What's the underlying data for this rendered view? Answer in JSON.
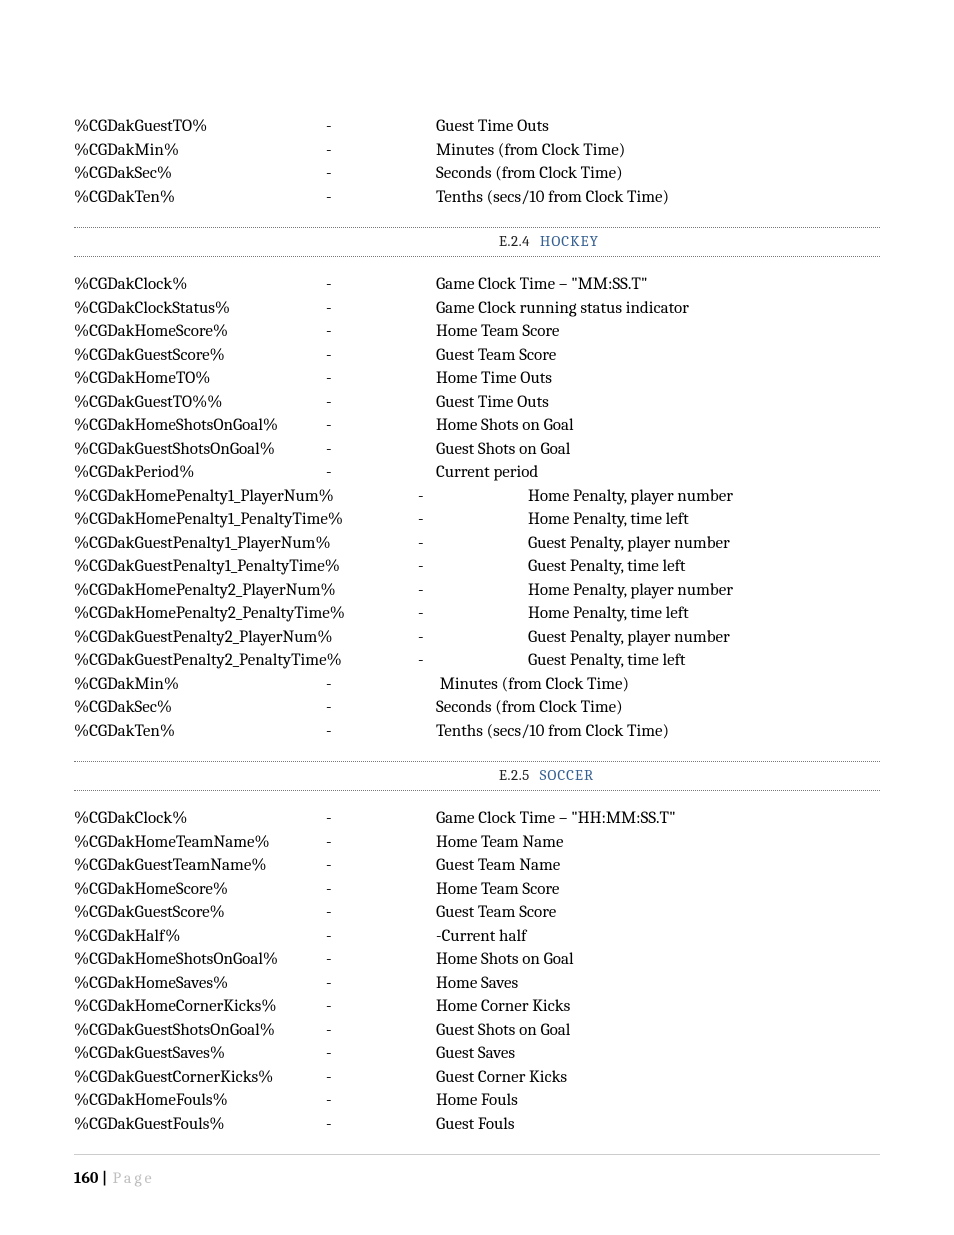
{
  "section_top": {
    "rows": [
      {
        "token": "%CGDakGuestTO%",
        "desc": "Guest Time Outs"
      },
      {
        "token": "%CGDakMin%",
        "desc": "Minutes (from Clock Time)"
      },
      {
        "token": "%CGDakSec%",
        "desc": "Seconds (from Clock Time)"
      },
      {
        "token": "%CGDakTen%",
        "desc": "Tenths (secs/10 from Clock Time)"
      }
    ]
  },
  "section_hockey": {
    "number": "E.2.4",
    "title": "HOCKEY",
    "narrow_rows": [
      {
        "token": "%CGDakClock%",
        "desc": "Game Clock Time – \"MM:SS.T\""
      },
      {
        "token": "%CGDakClockStatus%",
        "desc": "Game Clock running status indicator"
      },
      {
        "token": "%CGDakHomeScore%",
        "desc": "Home Team Score"
      },
      {
        "token": "%CGDakGuestScore%",
        "desc": "Guest Team Score"
      },
      {
        "token": "%CGDakHomeTO%",
        "desc": "Home Time Outs"
      },
      {
        "token": "%CGDakGuestTO%%",
        "desc": "Guest Time Outs"
      },
      {
        "token": "%CGDakHomeShotsOnGoal%",
        "desc": "Home Shots on Goal"
      },
      {
        "token": "%CGDakGuestShotsOnGoal%",
        "desc": "Guest Shots on Goal"
      },
      {
        "token": "%CGDakPeriod%",
        "desc": "Current period"
      }
    ],
    "wide_rows": [
      {
        "token": "%CGDakHomePenalty1_PlayerNum%",
        "desc": "Home Penalty, player number"
      },
      {
        "token": "%CGDakHomePenalty1_PenaltyTime%",
        "desc": "Home Penalty, time left"
      },
      {
        "token": "%CGDakGuestPenalty1_PlayerNum%",
        "desc": "Guest Penalty, player number"
      },
      {
        "token": "%CGDakGuestPenalty1_PenaltyTime%",
        "desc": "Guest Penalty, time left"
      },
      {
        "token": "%CGDakHomePenalty2_PlayerNum%",
        "desc": "Home Penalty, player number"
      },
      {
        "token": "%CGDakHomePenalty2_PenaltyTime%",
        "desc": "Home Penalty, time left"
      },
      {
        "token": "%CGDakGuestPenalty2_PlayerNum%",
        "desc": "Guest Penalty, player number"
      },
      {
        "token": "%CGDakGuestPenalty2_PenaltyTime%",
        "desc": "Guest Penalty, time left"
      }
    ],
    "tail_rows": [
      {
        "token": "%CGDakMin%",
        "desc": " Minutes (from Clock Time)"
      },
      {
        "token": "%CGDakSec%",
        "desc": "Seconds (from Clock Time)"
      },
      {
        "token": "%CGDakTen%",
        "desc": "Tenths (secs/10 from Clock Time)"
      }
    ]
  },
  "section_soccer": {
    "number": "E.2.5",
    "title": "SOCCER",
    "rows": [
      {
        "token": "%CGDakClock%",
        "desc": "Game Clock Time – \"HH:MM:SS.T\""
      },
      {
        "token": "%CGDakHomeTeamName%",
        "desc": "Home Team Name"
      },
      {
        "token": "%CGDakGuestTeamName%",
        "desc": "Guest Team Name"
      },
      {
        "token": "%CGDakHomeScore%",
        "desc": "Home Team Score"
      },
      {
        "token": "%CGDakGuestScore%",
        "desc": "Guest Team Score"
      },
      {
        "token": "%CGDakHalf%",
        "desc": "-Current half"
      },
      {
        "token": "%CGDakHomeShotsOnGoal%",
        "desc": "Home Shots on Goal"
      },
      {
        "token": "%CGDakHomeSaves%",
        "desc": "Home Saves"
      },
      {
        "token": "%CGDakHomeCornerKicks%",
        "desc": "Home Corner Kicks"
      },
      {
        "token": "%CGDakGuestShotsOnGoal%",
        "desc": "Guest Shots on Goal"
      },
      {
        "token": "%CGDakGuestSaves%",
        "desc": "Guest Saves"
      },
      {
        "token": "%CGDakGuestCornerKicks%",
        "desc": "Guest Corner Kicks"
      },
      {
        "token": "%CGDakHomeFouls%",
        "desc": "Home Fouls"
      },
      {
        "token": "%CGDakGuestFouls%",
        "desc": "Guest Fouls"
      }
    ]
  },
  "dash": "-",
  "footer": {
    "page": "160",
    "bar": "|",
    "word": "Page"
  }
}
